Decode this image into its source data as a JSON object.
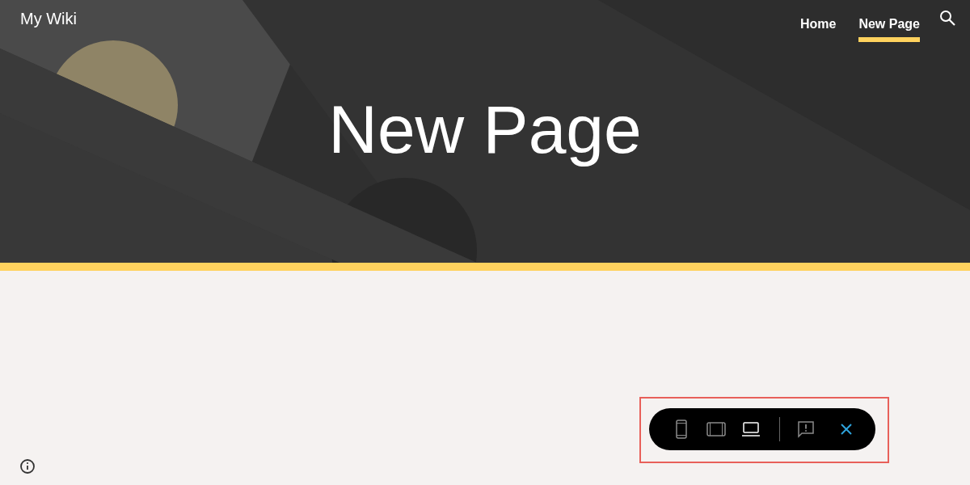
{
  "site": {
    "title": "My Wiki"
  },
  "nav": [
    {
      "label": "Home",
      "selected": false
    },
    {
      "label": "New Page",
      "selected": true
    }
  ],
  "header": {
    "kind": "picture",
    "title": "New Page"
  },
  "preview_toolbar": {
    "highlighted": true,
    "devices": [
      {
        "kind": "phone",
        "selected": false
      },
      {
        "kind": "tablet",
        "selected": false
      },
      {
        "kind": "laptop",
        "selected": true
      }
    ]
  }
}
